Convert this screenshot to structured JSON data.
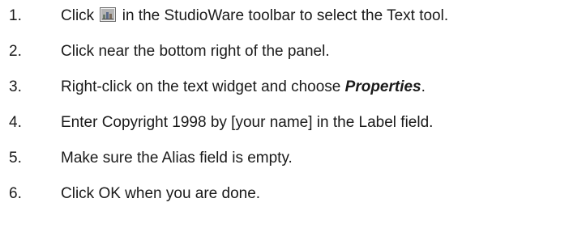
{
  "steps": [
    {
      "number": "1.",
      "before_icon": "Click ",
      "icon": "text-tool-icon",
      "after_icon": " in the StudioWare toolbar to select the Text tool."
    },
    {
      "number": "2.",
      "text": "Click near the bottom right of the panel."
    },
    {
      "number": "3.",
      "before_emphasis": "Right-click on the text widget and choose ",
      "emphasis": "Properties",
      "after_emphasis": "."
    },
    {
      "number": "4.",
      "text": "Enter Copyright 1998 by [your name] in the Label field."
    },
    {
      "number": "5.",
      "text": "Make sure the Alias field is empty."
    },
    {
      "number": "6.",
      "text": "Click OK when you are done."
    }
  ]
}
